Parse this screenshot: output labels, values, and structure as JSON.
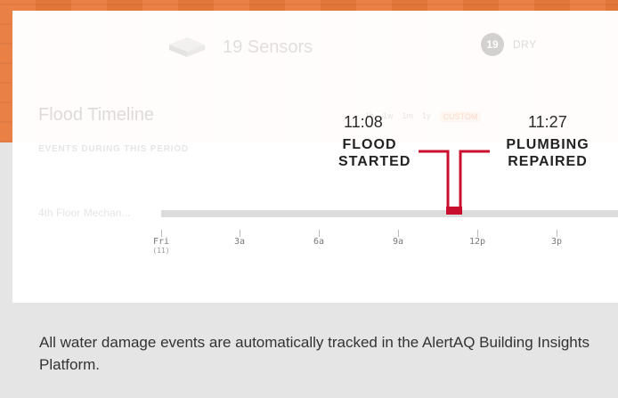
{
  "header": {
    "sensor_count_label": "19 Sensors",
    "badge_count": "19",
    "badge_status": "DRY"
  },
  "timeline": {
    "title": "Flood Timeline",
    "subtitle": "EVENTS DURING THIS PERIOD",
    "ranges": [
      "1h",
      "1w",
      "1m",
      "1y",
      "CUSTOM"
    ],
    "active_range": "CUSTOM",
    "row_label": "4th Floor Mechan...",
    "ticks": [
      {
        "label": "Fri",
        "sub": "(11)"
      },
      {
        "label": "3a",
        "sub": ""
      },
      {
        "label": "6a",
        "sub": ""
      },
      {
        "label": "9a",
        "sub": ""
      },
      {
        "label": "12p",
        "sub": ""
      },
      {
        "label": "3p",
        "sub": ""
      }
    ]
  },
  "annotations": {
    "start_time": "11:08",
    "start_label_line1": "FLOOD",
    "start_label_line2": "STARTED",
    "end_time": "11:27",
    "end_label_line1": "PLUMBING",
    "end_label_line2": "REPAIRED",
    "marker_color": "#c8102e"
  },
  "footer": {
    "caption": "All water damage events are automatically tracked in the AlertAQ Building Insights Platform."
  },
  "colors": {
    "accent": "#e87a3c"
  }
}
